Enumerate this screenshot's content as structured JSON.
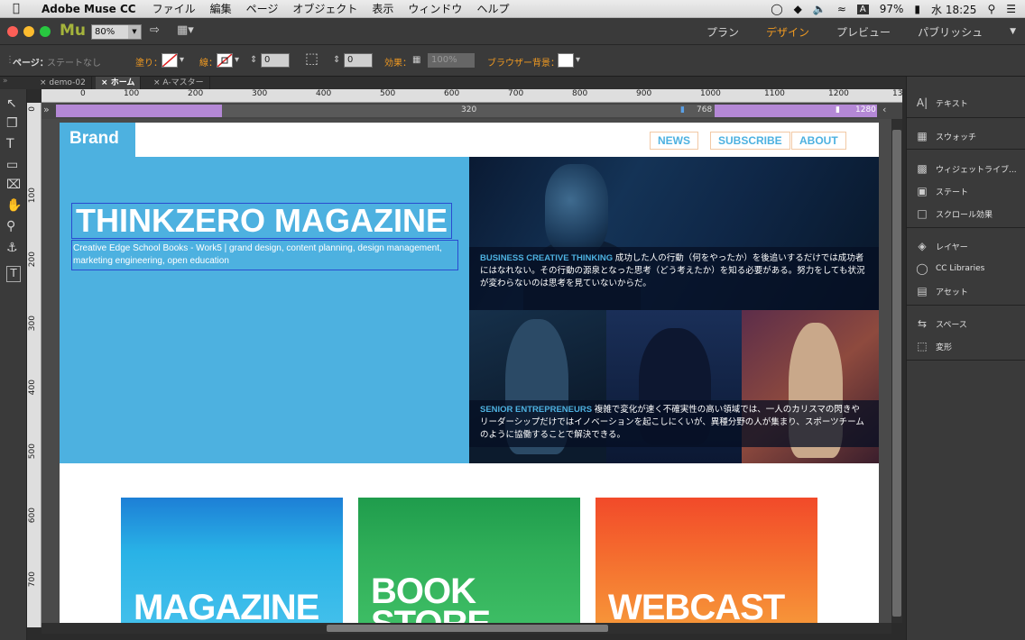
{
  "menubar": {
    "app_name": "Adobe Muse CC",
    "menus": [
      "ファイル",
      "編集",
      "ページ",
      "オブジェクト",
      "表示",
      "ウィンドウ",
      "ヘルプ"
    ],
    "battery": "97%",
    "clock": "水 18:25"
  },
  "toolbar": {
    "logo": "Mu",
    "zoom": "80%",
    "modes": [
      "プラン",
      "デザイン",
      "プレビュー",
      "パブリッシュ"
    ],
    "active_mode": "デザイン"
  },
  "control_bar": {
    "page_label": "ページ：",
    "page_state": "ステートなし",
    "fill_label": "塗り：",
    "stroke_label": "線：",
    "stroke_value": "0",
    "spacing_value": "0",
    "effects_label": "効果：",
    "opacity": "100%",
    "browser_bg_label": "ブラウザー背景："
  },
  "tabs": [
    "demo-02",
    "ホーム",
    "A-マスター"
  ],
  "active_tab": "ホーム",
  "ruler": {
    "h_ticks": [
      "0",
      "100",
      "200",
      "300",
      "400",
      "500",
      "600",
      "700",
      "800",
      "900",
      "1000",
      "1100",
      "1200",
      "13"
    ],
    "v_ticks": [
      "0",
      "100",
      "200",
      "300",
      "400",
      "500",
      "600",
      "700"
    ]
  },
  "breakpoints": {
    "current": "320",
    "mid": "768",
    "max": "1280"
  },
  "site": {
    "brand": "Brand",
    "nav": [
      "NEWS",
      "SUBSCRIBE",
      "ABOUT"
    ],
    "hero_title": "THINKZERO MAGAZINE",
    "hero_sub": "Creative Edge School Books - Work5 | grand design, content planning, design management, marketing engineering, open education",
    "caption1_head": "BUSINESS CREATIVE THINKING",
    "caption1_body": " 成功した人の行動（何をやったか）を後追いするだけでは成功者にはなれない。その行動の源泉となった思考（どう考えたか）を知る必要がある。努力をしても状況が変わらないのは思考を見ていないからだ。",
    "caption2_head": "SENIOR ENTREPRENEURS",
    "caption2_body": " 複雑で変化が速く不確実性の高い領域では、一人のカリスマの閃きやリーダーシップだけではイノベーションを起こしにくいが、異種分野の人が集まり、スポーツチームのように協働することで解決できる。",
    "cards": [
      "MAGAZINE",
      "BOOK STORE",
      "WEBCAST"
    ],
    "card_colors": [
      "#33a6dc",
      "#2fae58",
      "#f46a2e"
    ]
  },
  "panel": {
    "groups": [
      [
        "テキスト"
      ],
      [
        "スウォッチ"
      ],
      [
        "ウィジェットライブ...",
        "ステート",
        "スクロール効果"
      ],
      [
        "レイヤー",
        "CC Libraries",
        "アセット"
      ],
      [
        "スペース",
        "変形"
      ]
    ]
  }
}
